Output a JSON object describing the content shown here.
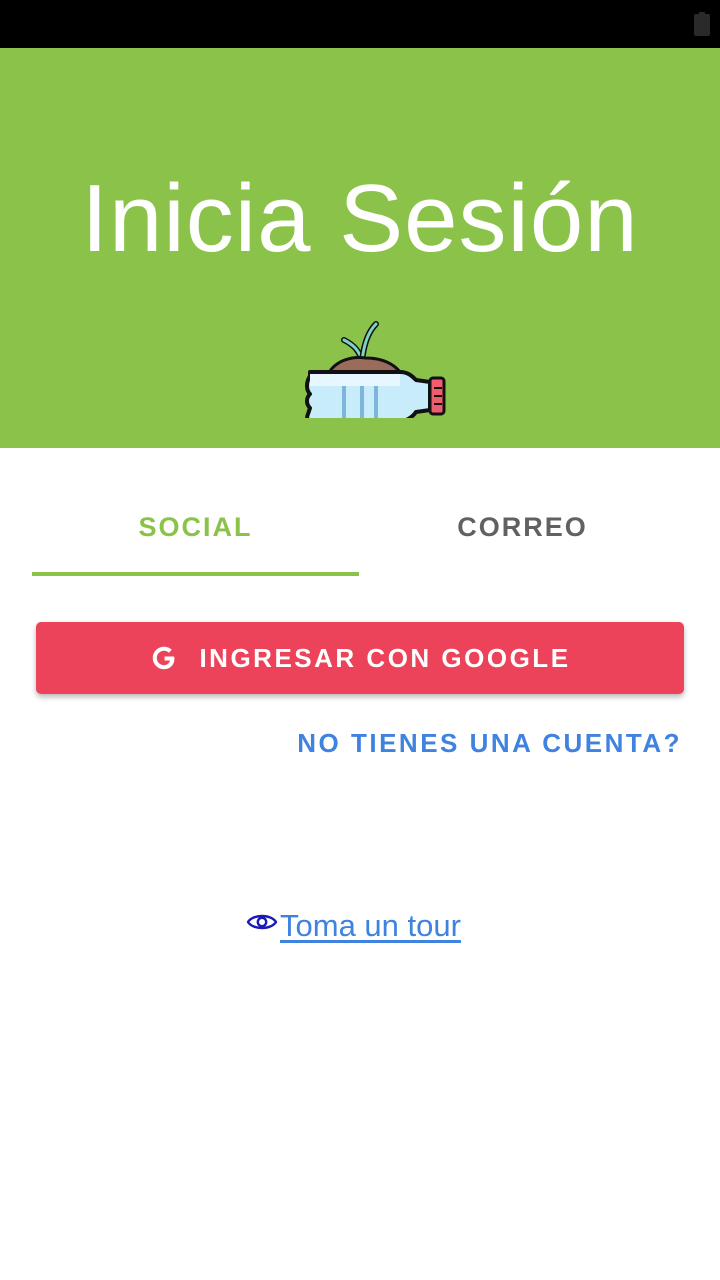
{
  "status_bar": {
    "icons": [
      "battery-icon"
    ]
  },
  "hero": {
    "title": "Inicia Sesión",
    "logo_icon": "plant-bottle-icon",
    "background": "#8bc34a"
  },
  "tabs": [
    {
      "label": "SOCIAL",
      "active": true
    },
    {
      "label": "CORREO",
      "active": false
    }
  ],
  "google_button": {
    "label": "INGRESAR CON GOOGLE",
    "icon": "google-icon",
    "color": "#ec435a"
  },
  "register_link": {
    "label": "NO TIENES UNA CUENTA?",
    "color": "#3f82e0"
  },
  "tour_link": {
    "label": " Toma un tour",
    "icon": "eye-icon"
  }
}
